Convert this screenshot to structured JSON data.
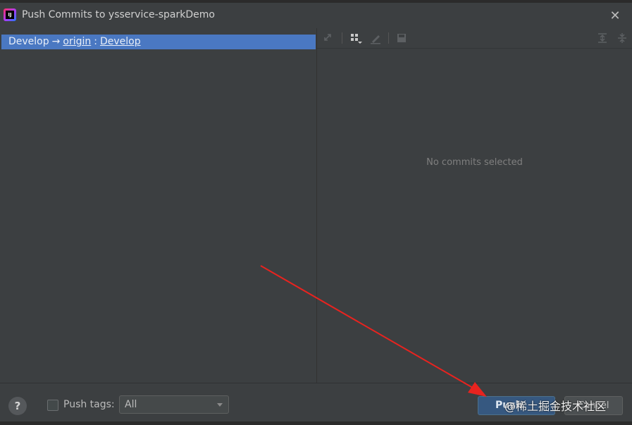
{
  "window": {
    "title": "Push Commits to ysservice-sparkDemo",
    "app_icon_text": "IJ"
  },
  "push_tree": {
    "local_branch": "Develop",
    "arrow": "→",
    "remote": "origin",
    "separator": ":",
    "remote_branch": "Develop"
  },
  "details": {
    "toolbar_icons": [
      "expand-arrows-icon",
      "group-by-icon",
      "edit-icon",
      "save-icon",
      "expand-all-icon",
      "collapse-all-icon"
    ],
    "empty_message": "No commits selected"
  },
  "footer": {
    "help_label": "?",
    "push_tags_label": "Push tags:",
    "push_tags_checked": false,
    "tags_select_value": "All",
    "push_label": "Push",
    "cancel_label": "Cancel"
  },
  "watermark": "@稀土掘金技术社区",
  "colors": {
    "background": "#3c3f41",
    "selection": "#4a78c2",
    "primary_button": "#365880",
    "annotation_arrow": "#e8231f"
  }
}
